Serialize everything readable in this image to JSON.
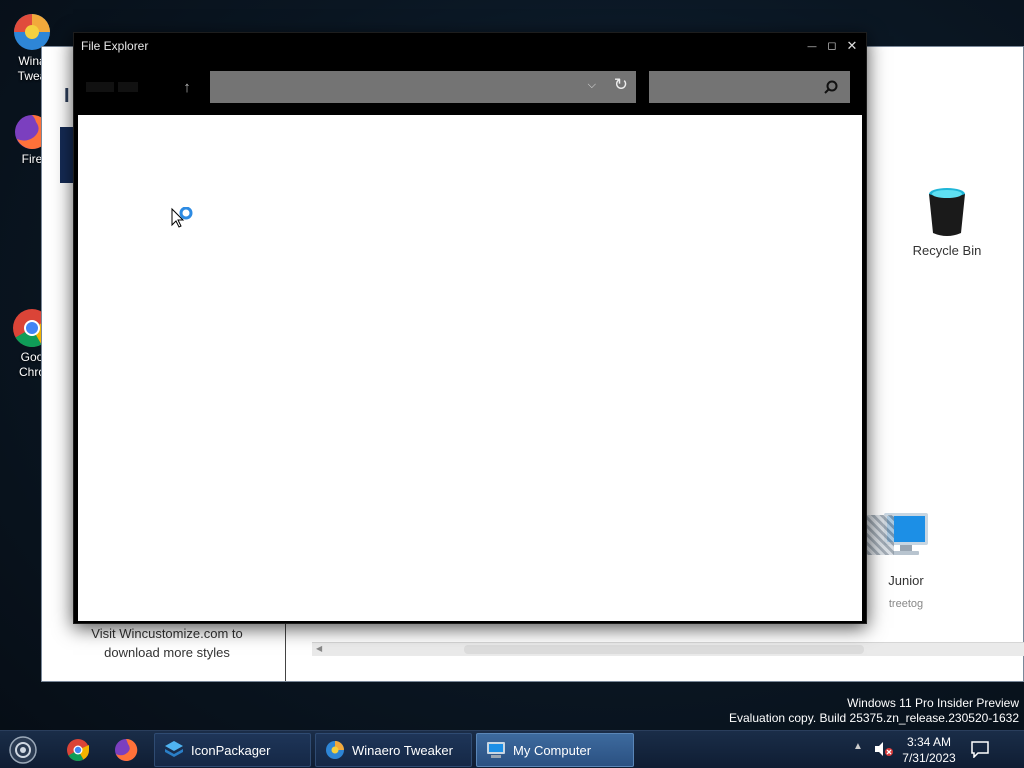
{
  "desktop": {
    "icons": [
      {
        "label": "Wina",
        "label2": "Twea"
      },
      {
        "label": "Fire"
      },
      {
        "label": "Goo",
        "label2": "Chro"
      },
      {
        "label": "Recycle Bin"
      }
    ]
  },
  "background_window": {
    "letter": "I",
    "promo_text": "Visit Wincustomize.com to download more styles",
    "icons": [
      {
        "label": "Junior",
        "sublabel": "treetog"
      }
    ]
  },
  "explorer": {
    "title": "File Explorer",
    "controls": {
      "minimize": "—",
      "maximize": "◻",
      "close": "✕"
    },
    "address_value": "",
    "search_placeholder": ""
  },
  "watermark": {
    "line1": "Windows 11 Pro Insider Preview",
    "line2": "Evaluation copy. Build 25375.zn_release.230520-1632"
  },
  "taskbar": {
    "apps": [
      {
        "label": "IconPackager"
      },
      {
        "label": "Winaero Tweaker"
      },
      {
        "label": "My Computer"
      }
    ],
    "clock": {
      "time": "3:34 AM",
      "date": "7/31/2023"
    }
  },
  "colors": {
    "taskbar_active": "#3d6a9e",
    "explorer_chrome": "#000000",
    "address_bg": "#747474"
  }
}
